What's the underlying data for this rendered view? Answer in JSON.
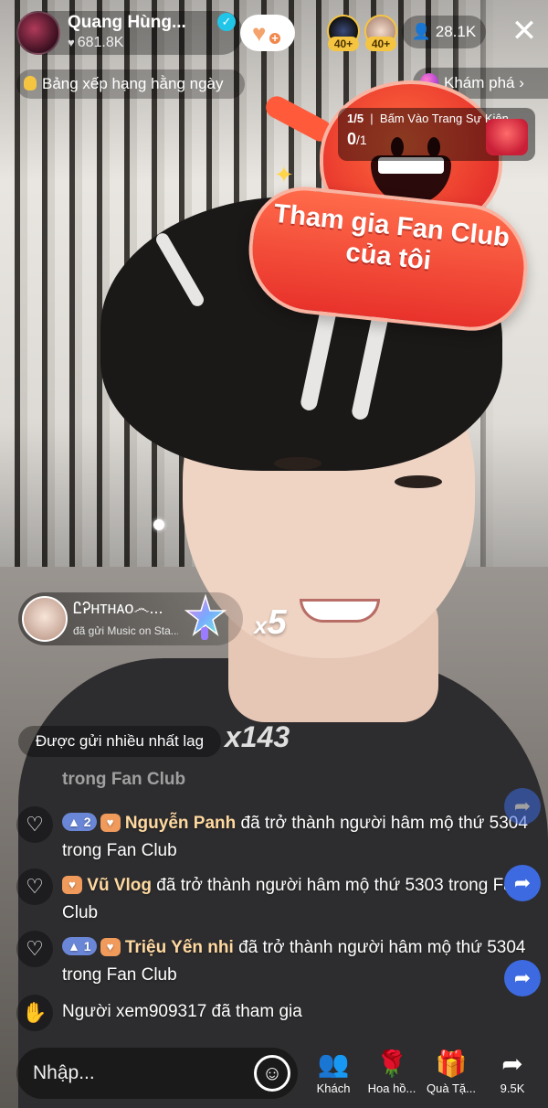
{
  "host": {
    "name": "Quang Hùng...",
    "likes": "681.8K"
  },
  "viewers": {
    "badges": [
      "40+",
      "40+"
    ],
    "count": "28.1K"
  },
  "ranking_label": "Bảng xếp hạng hằng ngày",
  "explore_label": "Khám phá",
  "event": {
    "step": "1/5",
    "title": "Bấm Vào Trang Sự Kiện",
    "progress_done": "0",
    "progress_total": "/1"
  },
  "fan_club_banner": {
    "line1": "Tham gia Fan Club",
    "line2": "của tôi"
  },
  "gift_toast": {
    "sender": "ᏝᎮʜᴛʜᴀᴏ෴...",
    "desc": "đã gửi Music on Sta...",
    "multiplier_prefix": "x",
    "multiplier_value": "5"
  },
  "most_sent": {
    "label": "Được gửi nhiều nhất lag",
    "multiplier": "x143"
  },
  "chat": {
    "faded_line": "trong Fan Club",
    "messages": [
      {
        "level": "2",
        "user": "Nguyễn Panh",
        "text": "đã trở thành người hâm mộ thứ 5304 trong Fan Club"
      },
      {
        "level": "",
        "user": "Vũ Vlog",
        "text": "đã trở thành người hâm mộ thứ 5303 trong Fan Club"
      },
      {
        "level": "1",
        "user": "Triệu Yến nhi",
        "text": "đã trở thành người hâm mộ thứ 5304 trong Fan Club"
      }
    ],
    "join": "Người xem909317 đã tham gia"
  },
  "bottom_bar": {
    "placeholder": "Nhập...",
    "guests": "Khách",
    "rose": "Hoa hồ...",
    "gifts": "Quà Tặ...",
    "share_count": "9.5K"
  },
  "colors": {
    "fan_red": "#e8322b",
    "verified": "#20c5e8",
    "share_blue": "#3d6ae0"
  }
}
